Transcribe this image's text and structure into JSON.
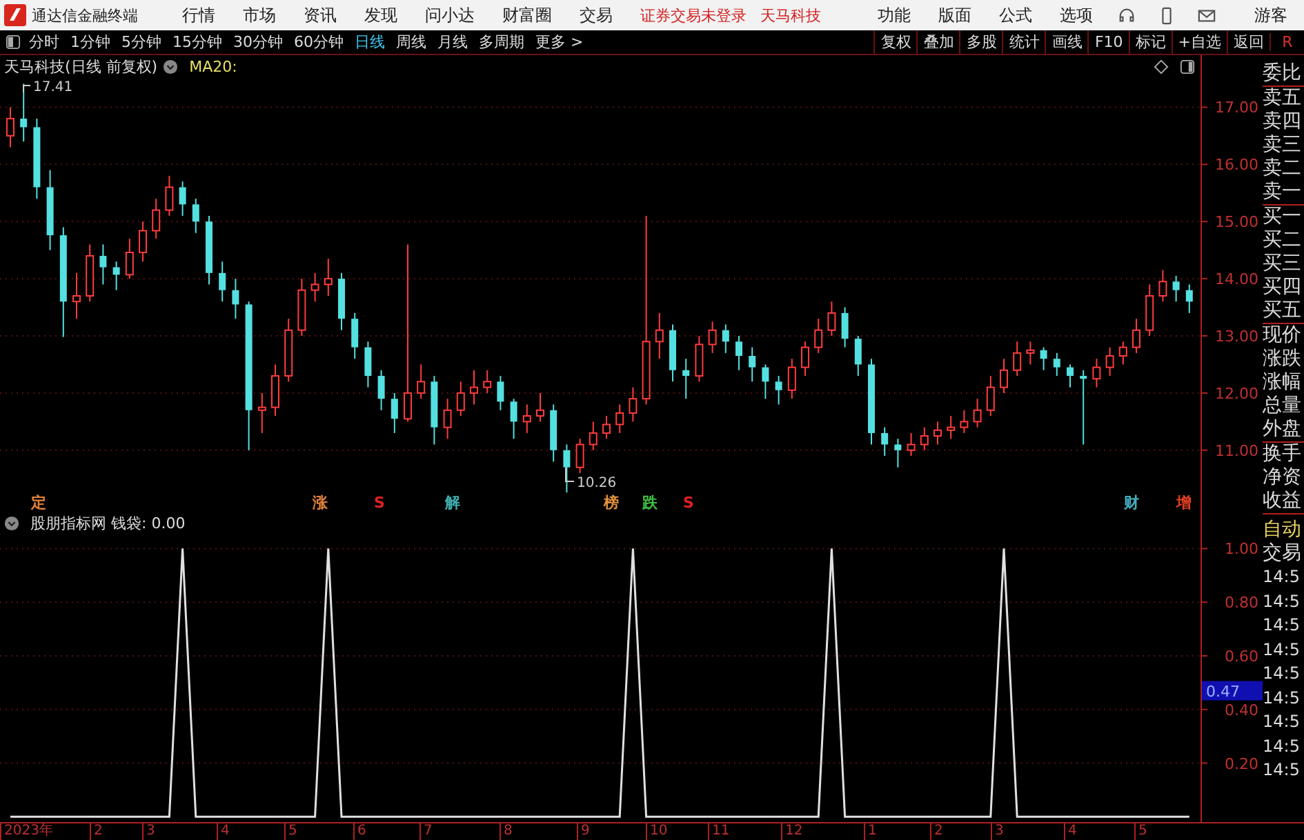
{
  "window": {
    "app_name": "通达信金融终端",
    "menu": [
      "行情",
      "市场",
      "资讯",
      "发现",
      "问小达",
      "财富圈",
      "交易"
    ],
    "notice": [
      "证券交易未登录",
      "天马科技"
    ],
    "right_menu": [
      "功能",
      "版面",
      "公式",
      "选项"
    ],
    "user": "游客"
  },
  "toolbar": {
    "periods": [
      {
        "label": "分时",
        "selected": false
      },
      {
        "label": "1分钟",
        "selected": false
      },
      {
        "label": "5分钟",
        "selected": false
      },
      {
        "label": "15分钟",
        "selected": false
      },
      {
        "label": "30分钟",
        "selected": false
      },
      {
        "label": "60分钟",
        "selected": false
      },
      {
        "label": "日线",
        "selected": true
      },
      {
        "label": "周线",
        "selected": false
      },
      {
        "label": "月线",
        "selected": false
      },
      {
        "label": "多周期",
        "selected": false
      },
      {
        "label": "更多 >",
        "selected": false
      }
    ],
    "actions": [
      "复权",
      "叠加",
      "多股",
      "统计",
      "画线",
      "F10",
      "标记",
      "+自选",
      "返回"
    ],
    "corner": "R"
  },
  "price_chart": {
    "title": "天马科技(日线 前复权)",
    "indicator": "MA20:",
    "high_label": "17.41",
    "low_label": "10.26",
    "markers": [
      {
        "label": "定",
        "color": "#e0803a"
      },
      {
        "label": "涨",
        "color": "#e0803a"
      },
      {
        "label": "S",
        "color": "#e02020"
      },
      {
        "label": "解",
        "color": "#40b0b0"
      },
      {
        "label": "榜",
        "color": "#e0903a"
      },
      {
        "label": "跌",
        "color": "#40c040"
      },
      {
        "label": "S",
        "color": "#e02020"
      },
      {
        "label": "财",
        "color": "#40b0c0"
      },
      {
        "label": "增",
        "color": "#e04020"
      }
    ],
    "chart_data": {
      "type": "candlestick",
      "categories": [
        null,
        null,
        null,
        null,
        null,
        null,
        null,
        null,
        null,
        null,
        null,
        null,
        null,
        null,
        null,
        null,
        null,
        null,
        null,
        null,
        null,
        null,
        null,
        null,
        null,
        null,
        null,
        null,
        null,
        null,
        null,
        null,
        null,
        null,
        null,
        null,
        null,
        null,
        null,
        null,
        null,
        null,
        null,
        null,
        null,
        null,
        null,
        null,
        null,
        null,
        null,
        null,
        null,
        null,
        null,
        null,
        null,
        null,
        null,
        null,
        null,
        null,
        null,
        null,
        null,
        null,
        null,
        null,
        null,
        null,
        null,
        null,
        null,
        null,
        null,
        null,
        null,
        null,
        null,
        null,
        null,
        null,
        null,
        null,
        null,
        null,
        null,
        null,
        null,
        null
      ],
      "ohlc": [
        [
          16.5,
          17.0,
          16.3,
          16.8
        ],
        [
          16.8,
          17.41,
          16.4,
          16.65
        ],
        [
          16.65,
          16.8,
          15.4,
          15.6
        ],
        [
          15.6,
          15.9,
          14.5,
          14.76
        ],
        [
          14.76,
          14.9,
          12.98,
          13.6
        ],
        [
          13.6,
          14.1,
          13.3,
          13.7
        ],
        [
          13.7,
          14.6,
          13.6,
          14.4
        ],
        [
          14.4,
          14.6,
          13.9,
          14.2
        ],
        [
          14.2,
          14.3,
          13.8,
          14.07
        ],
        [
          14.07,
          14.7,
          14.0,
          14.46
        ],
        [
          14.46,
          15.0,
          14.3,
          14.84
        ],
        [
          14.84,
          15.4,
          14.7,
          15.2
        ],
        [
          15.2,
          15.8,
          15.1,
          15.6
        ],
        [
          15.6,
          15.7,
          15.1,
          15.3
        ],
        [
          15.3,
          15.4,
          14.8,
          15.0
        ],
        [
          15.0,
          15.1,
          13.9,
          14.1
        ],
        [
          14.1,
          14.3,
          13.6,
          13.8
        ],
        [
          13.8,
          14.0,
          13.3,
          13.55
        ],
        [
          13.55,
          13.6,
          11.0,
          11.7
        ],
        [
          11.7,
          12.0,
          11.3,
          11.75
        ],
        [
          11.75,
          12.5,
          11.6,
          12.3
        ],
        [
          12.3,
          13.3,
          12.2,
          13.1
        ],
        [
          13.1,
          14.0,
          13.0,
          13.8
        ],
        [
          13.8,
          14.1,
          13.6,
          13.9
        ],
        [
          13.9,
          14.35,
          13.7,
          14.0
        ],
        [
          14.0,
          14.1,
          13.1,
          13.3
        ],
        [
          13.3,
          13.4,
          12.6,
          12.8
        ],
        [
          12.8,
          12.9,
          12.1,
          12.3
        ],
        [
          12.3,
          12.4,
          11.7,
          11.9
        ],
        [
          11.9,
          12.0,
          11.3,
          11.55
        ],
        [
          11.55,
          14.6,
          11.5,
          12.0
        ],
        [
          12.0,
          12.5,
          11.9,
          12.2
        ],
        [
          12.2,
          12.3,
          11.1,
          11.4
        ],
        [
          11.4,
          11.9,
          11.2,
          11.7
        ],
        [
          11.7,
          12.2,
          11.6,
          12.0
        ],
        [
          12.0,
          12.4,
          11.8,
          12.1
        ],
        [
          12.1,
          12.4,
          12.0,
          12.2
        ],
        [
          12.2,
          12.3,
          11.7,
          11.85
        ],
        [
          11.85,
          11.9,
          11.2,
          11.5
        ],
        [
          11.5,
          11.8,
          11.3,
          11.6
        ],
        [
          11.6,
          12.0,
          11.5,
          11.7
        ],
        [
          11.7,
          11.8,
          10.8,
          11.0
        ],
        [
          11.0,
          11.1,
          10.26,
          10.7
        ],
        [
          10.7,
          11.2,
          10.6,
          11.1
        ],
        [
          11.1,
          11.5,
          11.0,
          11.3
        ],
        [
          11.3,
          11.6,
          11.2,
          11.45
        ],
        [
          11.45,
          11.8,
          11.3,
          11.65
        ],
        [
          11.65,
          12.1,
          11.5,
          11.9
        ],
        [
          11.9,
          15.1,
          11.8,
          12.9
        ],
        [
          12.9,
          13.4,
          12.6,
          13.1
        ],
        [
          13.1,
          13.2,
          12.2,
          12.4
        ],
        [
          12.4,
          12.6,
          11.9,
          12.3
        ],
        [
          12.3,
          13.0,
          12.2,
          12.85
        ],
        [
          12.85,
          13.25,
          12.7,
          13.1
        ],
        [
          13.1,
          13.2,
          12.7,
          12.9
        ],
        [
          12.9,
          13.0,
          12.4,
          12.65
        ],
        [
          12.65,
          12.8,
          12.2,
          12.45
        ],
        [
          12.45,
          12.5,
          11.9,
          12.2
        ],
        [
          12.2,
          12.3,
          11.8,
          12.05
        ],
        [
          12.05,
          12.6,
          11.9,
          12.45
        ],
        [
          12.45,
          12.9,
          12.3,
          12.8
        ],
        [
          12.8,
          13.3,
          12.7,
          13.1
        ],
        [
          13.1,
          13.6,
          13.0,
          13.4
        ],
        [
          13.4,
          13.5,
          12.8,
          12.95
        ],
        [
          12.95,
          13.0,
          12.3,
          12.5
        ],
        [
          12.5,
          12.6,
          11.1,
          11.3
        ],
        [
          11.3,
          11.4,
          10.9,
          11.1
        ],
        [
          11.1,
          11.2,
          10.7,
          11.0
        ],
        [
          11.0,
          11.3,
          10.9,
          11.1
        ],
        [
          11.1,
          11.4,
          11.0,
          11.25
        ],
        [
          11.25,
          11.5,
          11.1,
          11.35
        ],
        [
          11.35,
          11.6,
          11.2,
          11.4
        ],
        [
          11.4,
          11.7,
          11.3,
          11.5
        ],
        [
          11.5,
          11.9,
          11.4,
          11.7
        ],
        [
          11.7,
          12.3,
          11.6,
          12.1
        ],
        [
          12.1,
          12.6,
          12.0,
          12.4
        ],
        [
          12.4,
          12.9,
          12.3,
          12.7
        ],
        [
          12.7,
          12.9,
          12.5,
          12.75
        ],
        [
          12.75,
          12.8,
          12.4,
          12.6
        ],
        [
          12.6,
          12.7,
          12.3,
          12.45
        ],
        [
          12.45,
          12.5,
          12.1,
          12.3
        ],
        [
          12.3,
          12.4,
          11.1,
          12.25
        ],
        [
          12.25,
          12.6,
          12.1,
          12.45
        ],
        [
          12.45,
          12.8,
          12.3,
          12.65
        ],
        [
          12.65,
          12.9,
          12.5,
          12.8
        ],
        [
          12.8,
          13.3,
          12.7,
          13.1
        ],
        [
          13.1,
          13.9,
          13.0,
          13.7
        ],
        [
          13.7,
          14.15,
          13.6,
          13.95
        ],
        [
          13.95,
          14.05,
          13.6,
          13.8
        ],
        [
          13.8,
          13.9,
          13.4,
          13.6
        ]
      ],
      "ylim": [
        9.9,
        17.5
      ],
      "grid": true,
      "yticks": [
        {
          "value": 17,
          "label": "17.00"
        },
        {
          "value": 16,
          "label": "16.00"
        },
        {
          "value": 15,
          "label": "15.00"
        },
        {
          "value": 14,
          "label": "14.00"
        },
        {
          "value": 13,
          "label": "13.00"
        },
        {
          "value": 12,
          "label": "12.00"
        },
        {
          "value": 11,
          "label": "11.00"
        }
      ]
    }
  },
  "indicator_chart": {
    "title": "股朋指标网 钱袋: 0.00",
    "cursor_value": "0.47",
    "chart_data": {
      "type": "line",
      "categories": [
        null,
        null,
        null,
        null,
        null,
        null,
        null,
        null,
        null,
        null,
        null,
        null,
        null,
        null,
        null,
        null,
        null,
        null,
        null,
        null,
        null,
        null,
        null,
        null,
        null,
        null,
        null,
        null,
        null,
        null,
        null,
        null,
        null,
        null,
        null,
        null,
        null,
        null,
        null,
        null,
        null,
        null,
        null,
        null,
        null,
        null,
        null,
        null,
        null,
        null,
        null,
        null,
        null,
        null,
        null,
        null,
        null,
        null,
        null,
        null,
        null,
        null,
        null,
        null,
        null,
        null,
        null,
        null,
        null,
        null,
        null,
        null,
        null,
        null,
        null,
        null,
        null,
        null,
        null,
        null,
        null,
        null,
        null,
        null,
        null,
        null,
        null,
        null,
        null,
        null
      ],
      "series": [
        {
          "color": "#e0e0e0",
          "values": [
            0,
            0,
            0,
            0,
            0,
            0,
            0,
            0,
            0,
            0,
            0,
            0,
            0,
            1,
            0,
            0,
            0,
            0,
            0,
            0,
            0,
            0,
            0,
            0,
            1,
            0,
            0,
            0,
            0,
            0,
            0,
            0,
            0,
            0,
            0,
            0,
            0,
            0,
            0,
            0,
            0,
            0,
            0,
            0,
            0,
            0,
            0,
            1,
            0,
            0,
            0,
            0,
            0,
            0,
            0,
            0,
            0,
            0,
            0,
            0,
            0,
            0,
            1,
            0,
            0,
            0,
            0,
            0,
            0,
            0,
            0,
            0,
            0,
            0,
            0,
            1,
            0,
            0,
            0,
            0,
            0,
            0,
            0,
            0,
            0,
            0,
            0,
            0,
            0,
            0
          ]
        }
      ],
      "ylim": [
        -0.025,
        1.05
      ],
      "grid": true,
      "yticks": [
        {
          "value": 1,
          "label": "1.00"
        },
        {
          "value": 0.8,
          "label": "0.80"
        },
        {
          "value": 0.6,
          "label": "0.60"
        },
        {
          "value": 0.4,
          "label": "0.40"
        },
        {
          "value": 0.2,
          "label": "0.20"
        }
      ]
    }
  },
  "x_axis": [
    "2023年",
    "2",
    "3",
    "4",
    "5",
    "6",
    "7",
    "8",
    "9",
    "10",
    "11",
    "12",
    "1",
    "2",
    "3",
    "4",
    "5"
  ],
  "quote_panel": [
    [
      "委比"
    ],
    [
      "卖五",
      "卖四",
      "卖三",
      "卖二",
      "卖一"
    ],
    [
      "买一",
      "买二",
      "买三",
      "买四",
      "买五"
    ],
    [
      "现价",
      "涨跌",
      "涨幅",
      "总量",
      "外盘"
    ],
    [
      "换手",
      "净资",
      "收益"
    ]
  ],
  "trade_panel": {
    "mode": "自动",
    "title": "交易",
    "times": [
      "14:5",
      "14:5",
      "14:5",
      "14:5",
      "14:5",
      "14:5",
      "14:5",
      "14:5",
      "14:5"
    ]
  }
}
